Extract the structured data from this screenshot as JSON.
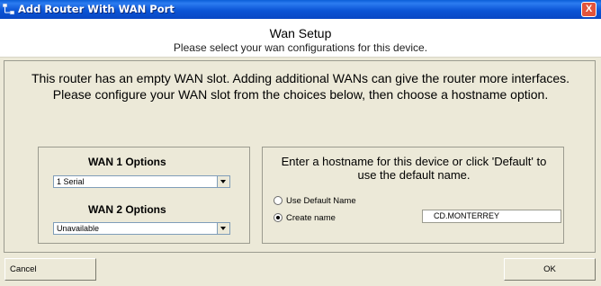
{
  "window": {
    "title": "Add Router With WAN Port",
    "close_label": "X"
  },
  "header": {
    "title": "Wan Setup",
    "subtitle": "Please select your wan configurations for this device."
  },
  "intro": "This router has an empty WAN slot. Adding additional WANs can give the router more interfaces. Please configure your WAN slot from the choices below, then choose a hostname option.",
  "wan": {
    "wan1_label": "WAN 1 Options",
    "wan1_value": "1 Serial",
    "wan2_label": "WAN 2 Options",
    "wan2_value": "Unavailable"
  },
  "hostname": {
    "prompt": "Enter a hostname for this device or click 'Default' to use the default name.",
    "option_default": "Use Default Name",
    "option_create": "Create name",
    "selected": "create",
    "value": "CD.MONTERREY"
  },
  "buttons": {
    "cancel": "Cancel",
    "ok": "OK"
  }
}
